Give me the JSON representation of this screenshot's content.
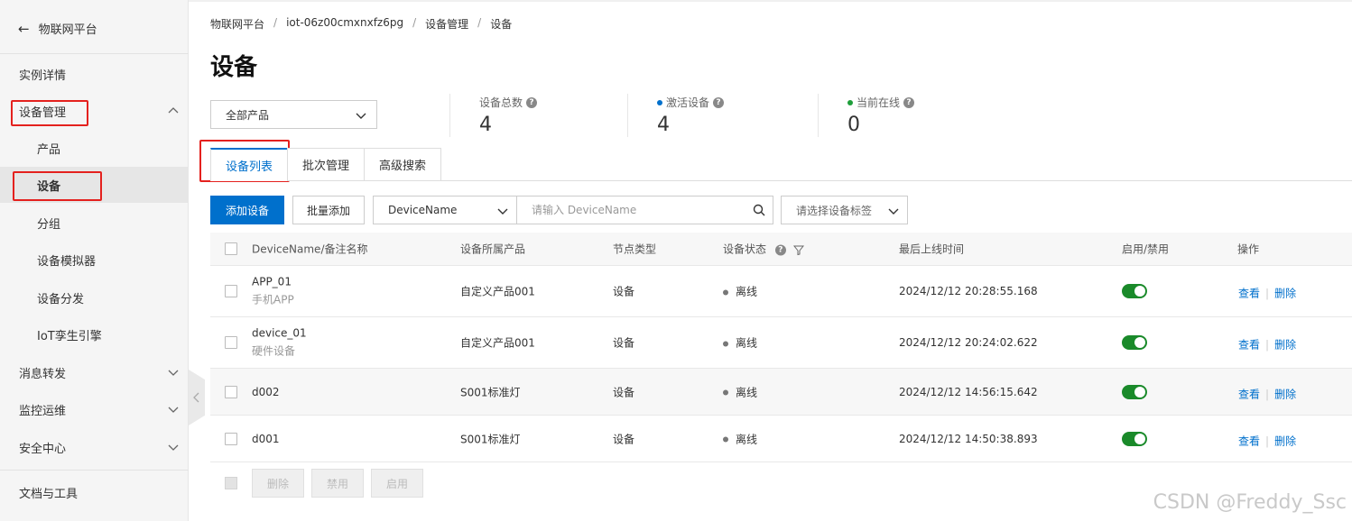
{
  "sidebar": {
    "back_label": "物联网平台",
    "items": [
      {
        "label": "实例详情"
      },
      {
        "label": "设备管理"
      },
      {
        "label": "产品"
      },
      {
        "label": "设备"
      },
      {
        "label": "分组"
      },
      {
        "label": "设备模拟器"
      },
      {
        "label": "设备分发"
      },
      {
        "label": "IoT孪生引擎"
      },
      {
        "label": "消息转发"
      },
      {
        "label": "监控运维"
      },
      {
        "label": "安全中心"
      },
      {
        "label": "文档与工具"
      }
    ]
  },
  "breadcrumb": [
    "物联网平台",
    "iot-06z00cmxnxfz6pg",
    "设备管理",
    "设备"
  ],
  "page_title": "设备",
  "product_filter": "全部产品",
  "stats": [
    {
      "label": "设备总数",
      "value": "4"
    },
    {
      "label": "激活设备",
      "value": "4",
      "dot_color": "#0070cc"
    },
    {
      "label": "当前在线",
      "value": "0",
      "dot_color": "#1e9e3a"
    }
  ],
  "tabs": [
    "设备列表",
    "批次管理",
    "高级搜索"
  ],
  "toolbar": {
    "add_device": "添加设备",
    "batch_add": "批量添加",
    "field_select": "DeviceName",
    "search_placeholder": "请输入 DeviceName",
    "tag_select": "请选择设备标签"
  },
  "table": {
    "headers": [
      "DeviceName/备注名称",
      "设备所属产品",
      "节点类型",
      "设备状态",
      "最后上线时间",
      "启用/禁用",
      "操作"
    ],
    "rows": [
      {
        "name": "APP_01",
        "note": "手机APP",
        "product": "自定义产品001",
        "node": "设备",
        "status": "离线",
        "last_online": "2024/12/12 20:28:55.168",
        "enabled": true
      },
      {
        "name": "device_01",
        "note": "硬件设备",
        "product": "自定义产品001",
        "node": "设备",
        "status": "离线",
        "last_online": "2024/12/12 20:24:02.622",
        "enabled": true
      },
      {
        "name": "d002",
        "note": "",
        "product": "S001标准灯",
        "node": "设备",
        "status": "离线",
        "last_online": "2024/12/12 14:56:15.642",
        "enabled": true
      },
      {
        "name": "d001",
        "note": "",
        "product": "S001标准灯",
        "node": "设备",
        "status": "离线",
        "last_online": "2024/12/12 14:50:38.893",
        "enabled": true
      }
    ],
    "action_view": "查看",
    "action_delete": "删除"
  },
  "footer_buttons": [
    "删除",
    "禁用",
    "启用"
  ],
  "watermark": "CSDN @Freddy_Ssc",
  "colors": {
    "accent": "#0070cc",
    "toggle_on": "#1a8a2a",
    "highlight": "#e4211e",
    "brand": "#ff6a00"
  }
}
